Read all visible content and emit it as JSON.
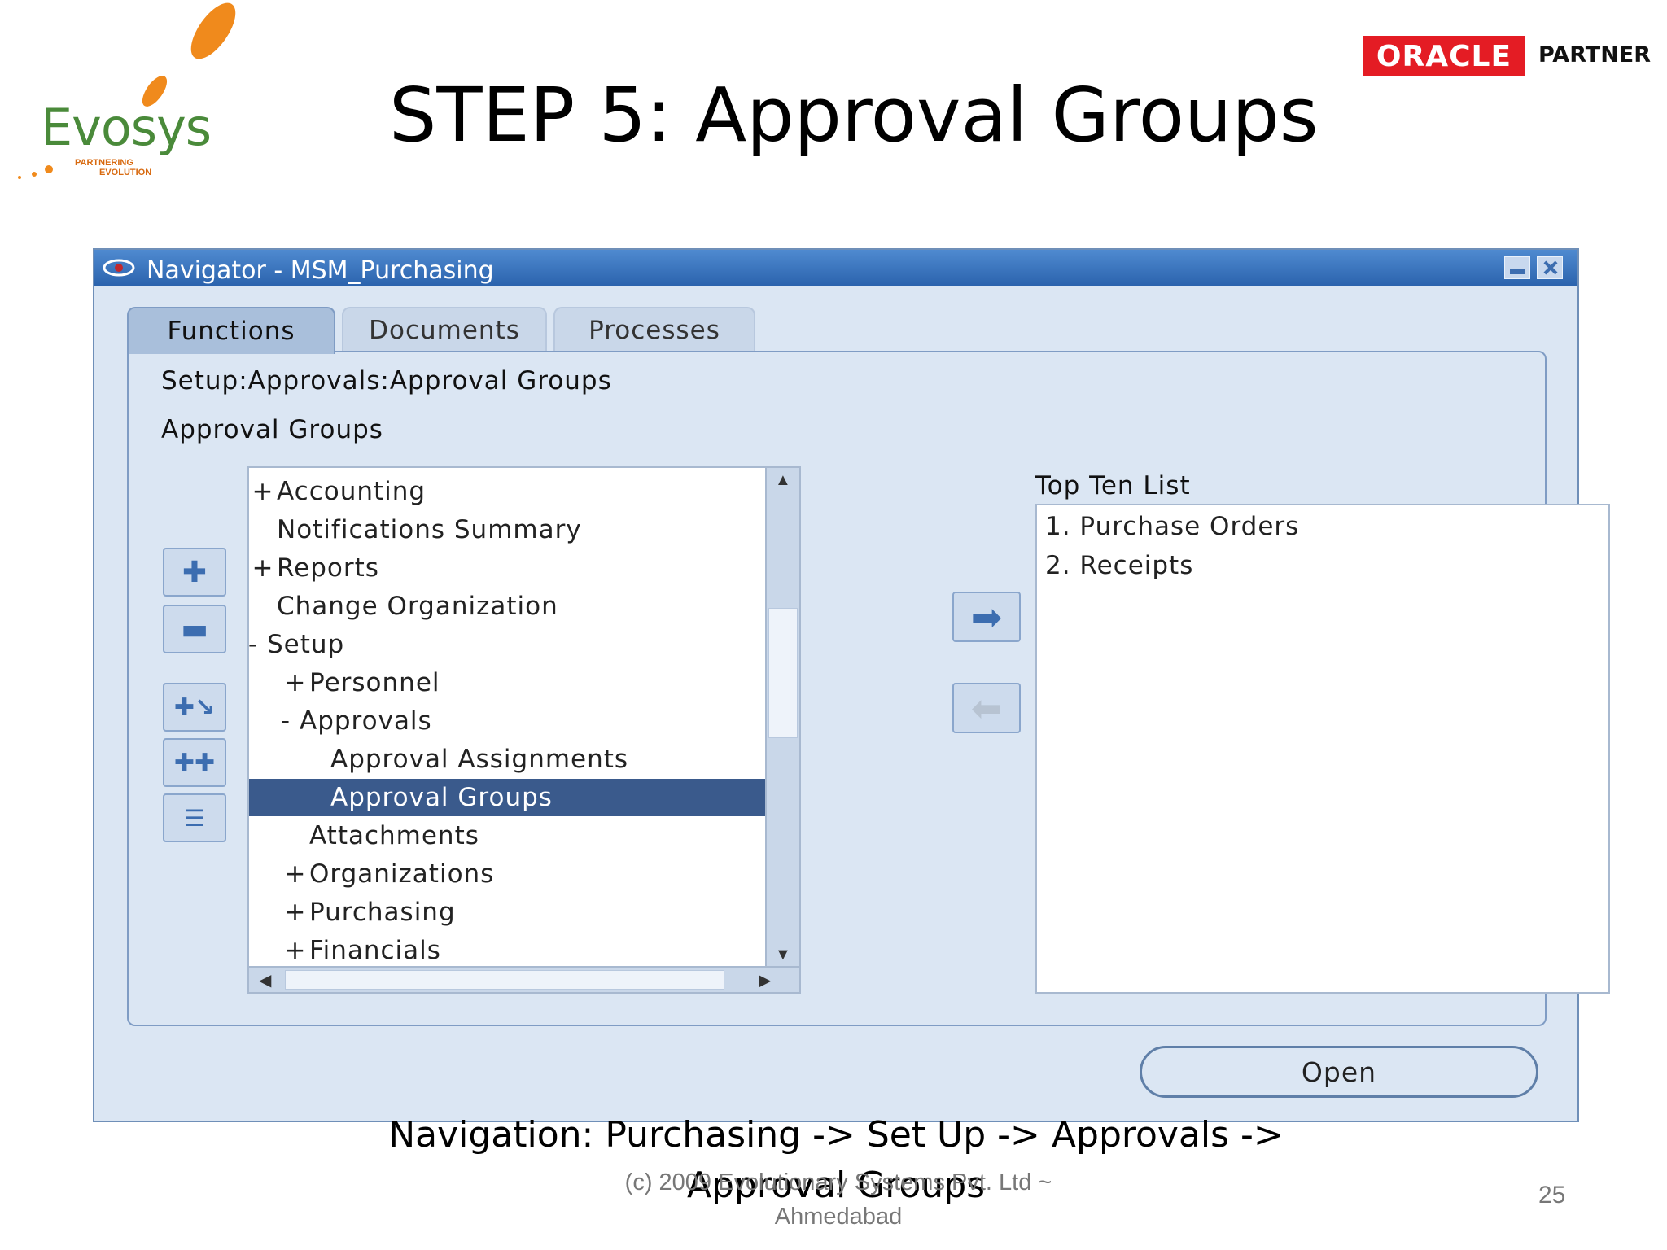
{
  "slide": {
    "logo_text": "Evosys",
    "logo_tagline_1": "PARTNERING",
    "logo_tagline_2": "EVOLUTION",
    "title": "STEP 5: Approval Groups",
    "partner_brand": "ORACLE",
    "partner_label": "PARTNER",
    "navigation_caption": "Navigation: Purchasing -> Set Up -> Approvals -> Approval Groups",
    "copyright": "(c) 2009 Evolutionary Systems Pvt. Ltd ~ Ahmedabad",
    "page_number": "25"
  },
  "window": {
    "title": "Navigator - MSM_Purchasing",
    "tabs": [
      {
        "label": "Functions",
        "active": true
      },
      {
        "label": "Documents",
        "active": false
      },
      {
        "label": "Processes",
        "active": false
      }
    ],
    "path": "Setup:Approvals:Approval Groups",
    "selected_name": "Approval Groups",
    "tree": [
      {
        "expander": "+",
        "label": "Accounting",
        "indent": 0
      },
      {
        "expander": "",
        "label": "Notifications Summary",
        "indent": 0
      },
      {
        "expander": "+",
        "label": "Reports",
        "indent": 0
      },
      {
        "expander": "",
        "label": "Change Organization",
        "indent": 0
      },
      {
        "expander": "-",
        "label": "Setup",
        "indent": 0
      },
      {
        "expander": "+",
        "label": "Personnel",
        "indent": 1
      },
      {
        "expander": "-",
        "label": "Approvals",
        "indent": 1
      },
      {
        "expander": "",
        "label": "Approval Assignments",
        "indent": 2
      },
      {
        "expander": "",
        "label": "Approval Groups",
        "indent": 2,
        "selected": true
      },
      {
        "expander": "",
        "label": "Attachments",
        "indent": 1
      },
      {
        "expander": "+",
        "label": "Organizations",
        "indent": 1
      },
      {
        "expander": "+",
        "label": "Purchasing",
        "indent": 1
      },
      {
        "expander": "+",
        "label": "Financials",
        "indent": 1
      }
    ],
    "top_ten_label": "Top Ten List",
    "top_ten": [
      "1. Purchase Orders",
      "2. Receipts"
    ],
    "open_button": "Open",
    "colors": {
      "titlebar": "#2b63ad",
      "selection": "#3a5a8c",
      "window_bg": "#dbe6f3"
    }
  }
}
